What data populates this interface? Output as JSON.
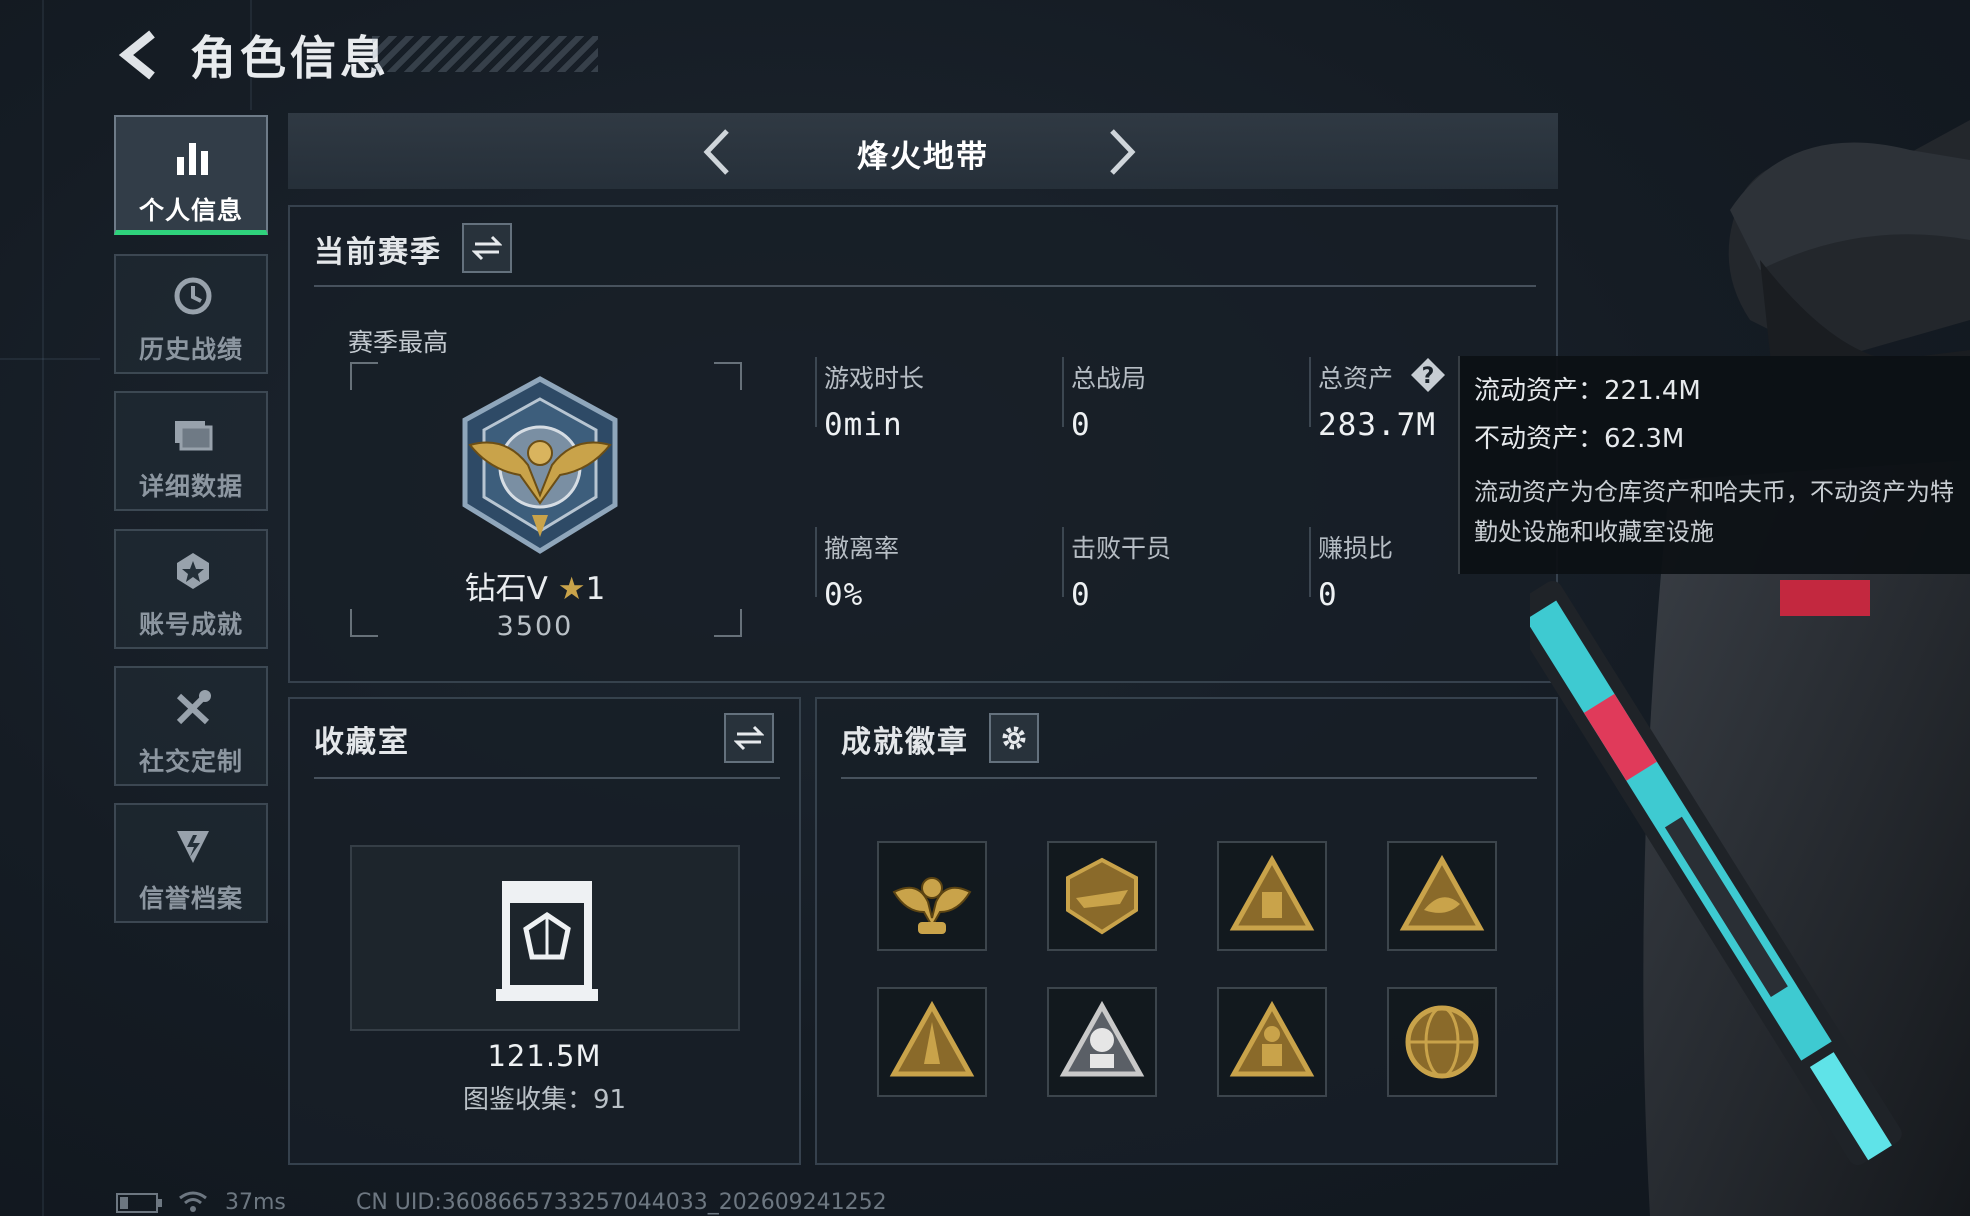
{
  "header": {
    "title": "角色信息"
  },
  "sidebar": {
    "items": [
      {
        "label": "个人信息",
        "active": true
      },
      {
        "label": "历史战绩",
        "active": false
      },
      {
        "label": "详细数据",
        "active": false
      },
      {
        "label": "账号成就",
        "active": false
      },
      {
        "label": "社交定制",
        "active": false
      },
      {
        "label": "信誉档案",
        "active": false
      }
    ]
  },
  "mode": {
    "title": "烽火地带"
  },
  "season": {
    "heading": "当前赛季",
    "best_label": "赛季最高",
    "rank_name": "钻石V",
    "rank_stars": "1",
    "rank_score": "3500",
    "stats": [
      {
        "label": "游戏时长",
        "value": "0min"
      },
      {
        "label": "总战局",
        "value": "0"
      },
      {
        "label": "总资产",
        "value": "283.7M"
      },
      {
        "label": "撤离率",
        "value": "0%"
      },
      {
        "label": "击败干员",
        "value": "0"
      },
      {
        "label": "赚损比",
        "value": "0"
      }
    ]
  },
  "tooltip": {
    "liquid": "流动资产：221.4M",
    "fixed": "不动资产：62.3M",
    "desc": "流动资产为仓库资产和哈夫币，不动资产为特勤处设施和收藏室设施"
  },
  "collection": {
    "heading": "收藏室",
    "value": "121.5M",
    "catalog": "图鉴收集：91"
  },
  "achievements": {
    "heading": "成就徽章",
    "badges": [
      "eagle-badge-icon",
      "emblem-badge-icon",
      "triangle-badge-icon",
      "triangle-fish-badge-icon",
      "triangle-tower-badge-icon",
      "triangle-robot-badge-icon",
      "triangle-soldier-badge-icon",
      "globe-badge-icon"
    ]
  },
  "footer": {
    "ping": "37ms",
    "uid": "CN UID:3608665733257044033_202609241252"
  },
  "colors": {
    "accent_green": "#2fd27c",
    "gold": "#c9a34a"
  }
}
